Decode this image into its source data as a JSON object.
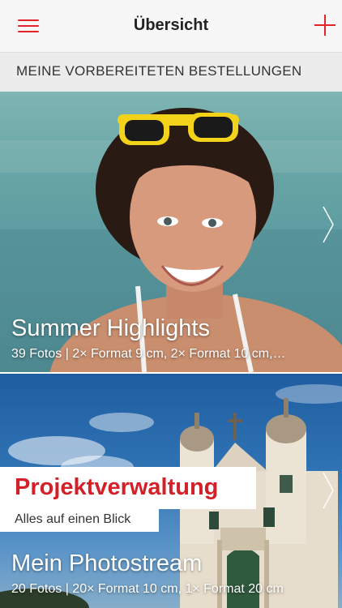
{
  "header": {
    "title": "Übersicht",
    "menu_icon": "hamburger-menu-icon",
    "add_icon": "plus-icon",
    "accent_color": "#e2232a"
  },
  "section": {
    "title": "MEINE VORBEREITETEN BESTELLUNGEN"
  },
  "orders": [
    {
      "title": "Summer Highlights",
      "subtitle": "39 Fotos | 2× Format 9 cm, 2× Format 10 cm,…",
      "image": "woman with yellow sunglasses smiling at the beach"
    },
    {
      "title": "Mein Photostream",
      "subtitle": "20 Fotos | 20× Format 10 cm, 1× Format 20 cm",
      "image": "baroque church under blue sky"
    }
  ],
  "promo": {
    "headline": "Projektverwaltung",
    "subline": "Alles auf einen Blick",
    "headline_color": "#d42129"
  }
}
